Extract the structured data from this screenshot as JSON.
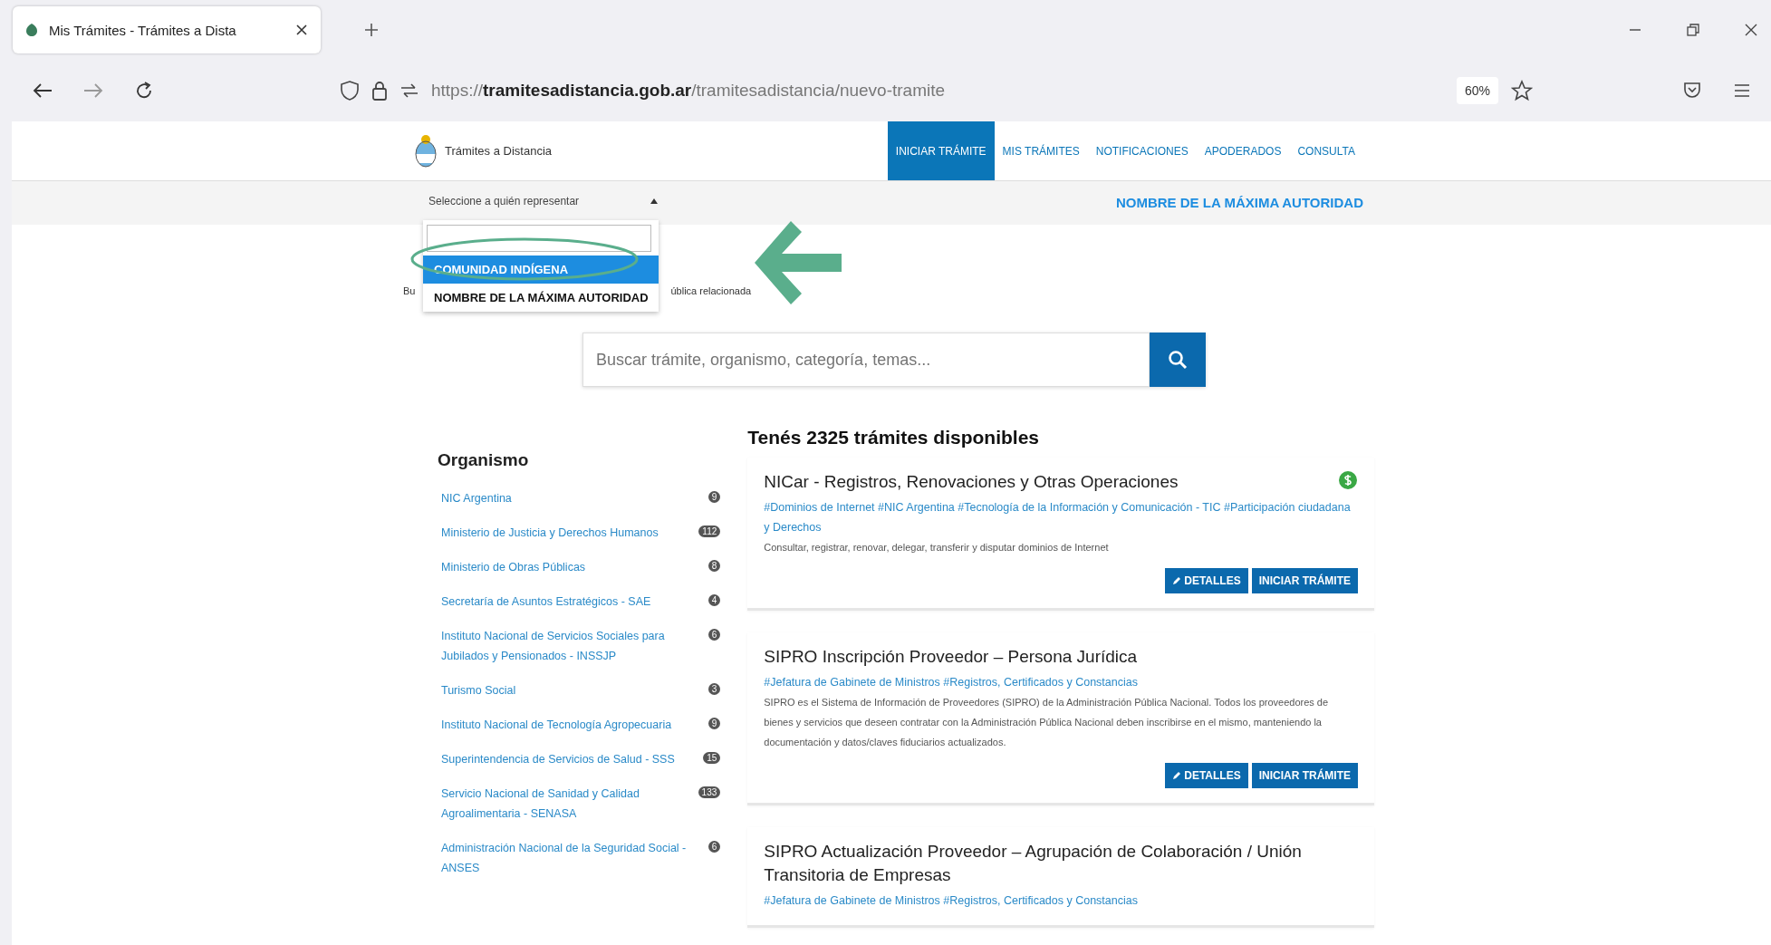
{
  "browser": {
    "tabs": [
      {
        "title": "Mis Trámites - Trámites a Dista",
        "selected": true
      }
    ],
    "url": {
      "scheme": "https://",
      "domain": "tramitesadistancia.gob.ar",
      "path": "/tramitesadistancia/nuevo-tramite"
    },
    "zoom": "60%"
  },
  "header": {
    "site_name": "Trámites a Distancia",
    "nav": [
      {
        "label": "INICIAR TRÁMITE",
        "selected": true
      },
      {
        "label": "MIS TRÁMITES",
        "selected": false
      },
      {
        "label": "NOTIFICACIONES",
        "selected": false
      },
      {
        "label": "APODERADOS",
        "selected": false
      },
      {
        "label": "CONSULTA",
        "selected": false
      }
    ]
  },
  "representation_bar": {
    "label": "Seleccione a quién representar",
    "current": "NOMBRE DE LA MÁXIMA AUTORIDAD",
    "dropdown": {
      "expanded": true,
      "options": [
        {
          "label": "COMUNIDAD INDÍGENA",
          "selected": true
        },
        {
          "label": "NOMBRE DE LA MÁXIMA AUTORIDAD",
          "selected": false
        }
      ]
    }
  },
  "covered_text": [
    "Bu",
    "ública relacionada"
  ],
  "search": {
    "placeholder": "Buscar trámite, organismo, categoría, temas..."
  },
  "filters": {
    "title": "Organismo",
    "items": [
      {
        "name": "NIC Argentina",
        "count": "9"
      },
      {
        "name": "Ministerio de Justicia y Derechos Humanos",
        "count": "112"
      },
      {
        "name": "Ministerio de Obras Públicas",
        "count": "8"
      },
      {
        "name": "Secretaría de Asuntos Estratégicos - SAE",
        "count": "4"
      },
      {
        "name": "Instituto Nacional de Servicios Sociales para Jubilados y Pensionados - INSSJP",
        "count": "6"
      },
      {
        "name": "Turismo Social",
        "count": "3"
      },
      {
        "name": "Instituto Nacional de Tecnología Agropecuaria",
        "count": "9"
      },
      {
        "name": "Superintendencia de Servicios de Salud - SSS",
        "count": "15"
      },
      {
        "name": "Servicio Nacional de Sanidad y Calidad Agroalimentaria - SENASA",
        "count": "133"
      },
      {
        "name": "Administración Nacional de la Seguridad Social - ANSES",
        "count": "6"
      }
    ]
  },
  "results": {
    "title": "Tenés 2325 trámites disponibles",
    "cards": [
      {
        "title": "NICar - Registros, Renovaciones y Otras Operaciones",
        "paid": true,
        "tags": "#Dominios de Internet #NIC Argentina #Tecnología de la Información y Comunicación - TIC #Participación ciudadana y Derechos",
        "description": "Consultar, registrar, renovar, delegar, transferir y disputar dominios de Internet",
        "buttons": [
          {
            "kind": "details",
            "label": "DETALLES"
          },
          {
            "kind": "start",
            "label": "INICIAR TRÁMITE"
          }
        ]
      },
      {
        "title": "SIPRO Inscripción Proveedor – Persona Jurídica",
        "paid": false,
        "tags": "#Jefatura de Gabinete de Ministros #Registros, Certificados y Constancias",
        "description": "SIPRO es el Sistema de Información de Proveedores (SIPRO) de la Administración Pública Nacional. Todos los proveedores de bienes y servicios que deseen contratar con la Administración Pública Nacional deben inscribirse en el mismo, manteniendo la documentación y datos/claves fiduciarios actualizados.",
        "buttons": [
          {
            "kind": "details",
            "label": "DETALLES"
          },
          {
            "kind": "start",
            "label": "INICIAR TRÁMITE"
          }
        ]
      },
      {
        "title": "SIPRO Actualización Proveedor – Agrupación de Colaboración / Unión Transitoria de Empresas",
        "paid": false,
        "tags": "#Jefatura de Gabinete de Ministros #Registros, Certificados y Constancias"
      }
    ]
  }
}
